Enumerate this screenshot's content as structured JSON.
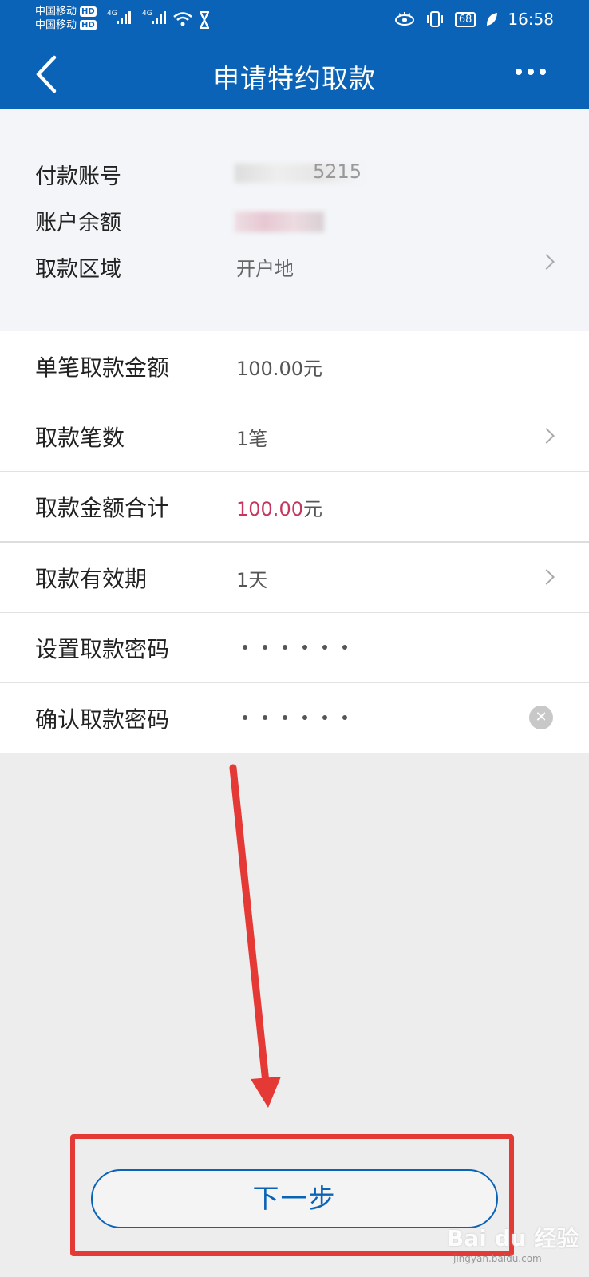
{
  "status_bar": {
    "carrier1": "中国移动",
    "carrier2": "中国移动",
    "hd": "HD",
    "net": "4G",
    "battery": "68",
    "time": "16:58"
  },
  "nav": {
    "title": "申请特约取款"
  },
  "info": [
    {
      "label": "付款账号",
      "value": "5215"
    },
    {
      "label": "账户余额",
      "value": ""
    },
    {
      "label": "取款区域",
      "value": "开户地"
    }
  ],
  "form": {
    "single_amount_label": "单笔取款金额",
    "single_amount_value": "100.00元",
    "count_label": "取款笔数",
    "count_value": "1笔",
    "total_label": "取款金额合计",
    "total_number": "100.00",
    "total_unit": "元",
    "validity_label": "取款有效期",
    "validity_value": "1天",
    "set_pwd_label": "设置取款密码",
    "confirm_pwd_label": "确认取款密码"
  },
  "next_button": "下一步",
  "watermark": {
    "logo": "Bai du 经验",
    "url": "jingyan.baidu.com"
  },
  "colors": {
    "brand": "#0a63b6",
    "highlight": "#c6365f",
    "annotation": "#e53935"
  }
}
